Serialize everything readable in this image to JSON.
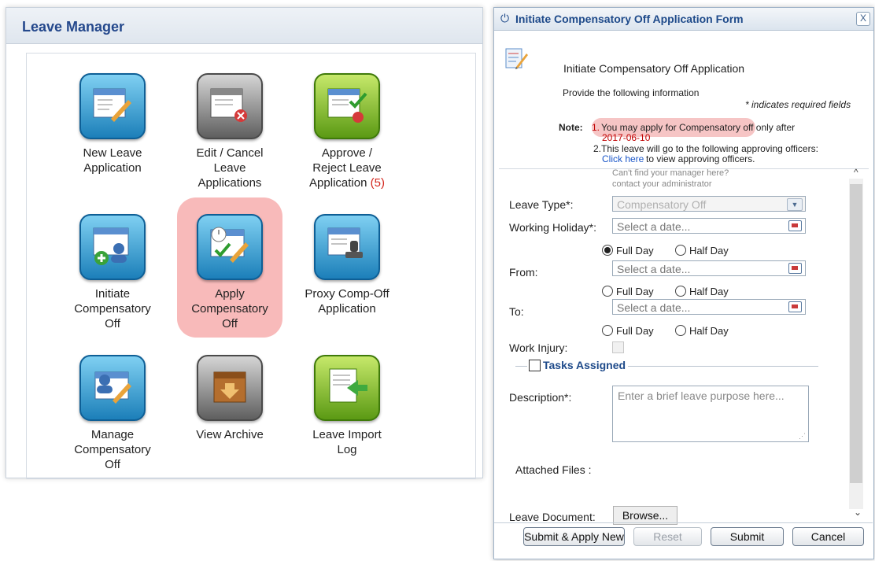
{
  "leave_manager": {
    "title": "Leave Manager",
    "tiles": [
      {
        "id": "new-leave",
        "icon": "document-edit-icon",
        "color": "blue",
        "line1": "New Leave",
        "line2": "Application",
        "line3": ""
      },
      {
        "id": "edit-cancel",
        "icon": "document-cancel-icon",
        "color": "gray",
        "line1": "Edit / Cancel",
        "line2": "Leave",
        "line3": "Applications"
      },
      {
        "id": "approve-reject",
        "icon": "document-approve-icon",
        "color": "green",
        "line1": "Approve /",
        "line2": "Reject Leave",
        "line3": "Application ",
        "badge": "(5)"
      },
      {
        "id": "initiate-comp-off",
        "icon": "user-add-icon",
        "color": "blue",
        "line1": "Initiate",
        "line2": "Compensatory",
        "line3": "Off"
      },
      {
        "id": "apply-comp-off",
        "icon": "calendar-edit-icon",
        "color": "blue",
        "line1": "Apply",
        "line2": "Compensatory",
        "line3": "Off"
      },
      {
        "id": "proxy-comp-off",
        "icon": "stamp-icon",
        "color": "blue",
        "line1": "Proxy Comp-Off",
        "line2": "Application",
        "line3": ""
      },
      {
        "id": "manage-comp-off",
        "icon": "user-edit-icon",
        "color": "blue",
        "line1": "Manage",
        "line2": "Compensatory",
        "line3": "Off"
      },
      {
        "id": "view-archive",
        "icon": "archive-box-icon",
        "color": "gray",
        "line1": "View Archive",
        "line2": "",
        "line3": ""
      },
      {
        "id": "leave-import-log",
        "icon": "import-arrow-icon",
        "color": "green",
        "line1": "Leave Import",
        "line2": "Log",
        "line3": ""
      }
    ]
  },
  "dialog": {
    "title": "Initiate Compensatory Off Application Form",
    "close_label": "X",
    "heading": "Initiate Compensatory Off Application",
    "instruction": "Provide the following information",
    "required_note": "* indicates required fields",
    "note_label": "Note:",
    "note1_prefix": "1.",
    "note1_text": "You may apply for Compensatory off only after",
    "note1_date": "2017-06-10",
    "note2_text": "2.This leave will go to the following approving officers:",
    "note2_link": "Click here",
    "note2_suffix": " to view approving officers.",
    "manager_hint1": "Can't find your manager here?",
    "manager_hint2": "contact your administrator",
    "fields": {
      "leave_type_label": "Leave Type*:",
      "leave_type_value": "Compensatory Off",
      "working_holiday_label": "Working Holiday*:",
      "working_holiday_placeholder": "Select a date...",
      "from_label": "From:",
      "from_placeholder": "Select a date...",
      "to_label": "To:",
      "to_placeholder": "Select a date...",
      "full_day": "Full Day",
      "half_day": "Half Day",
      "work_injury_label": "Work Injury:",
      "tasks_assigned_label": "Tasks Assigned",
      "description_label": "Description*:",
      "description_placeholder": "Enter a brief leave purpose here...",
      "attached_files_label": "Attached Files :",
      "leave_document_label": "Leave Document:",
      "browse_label": "Browse..."
    },
    "buttons": {
      "submit_apply_new": "Submit & Apply New",
      "reset": "Reset",
      "submit": "Submit",
      "cancel": "Cancel"
    }
  }
}
